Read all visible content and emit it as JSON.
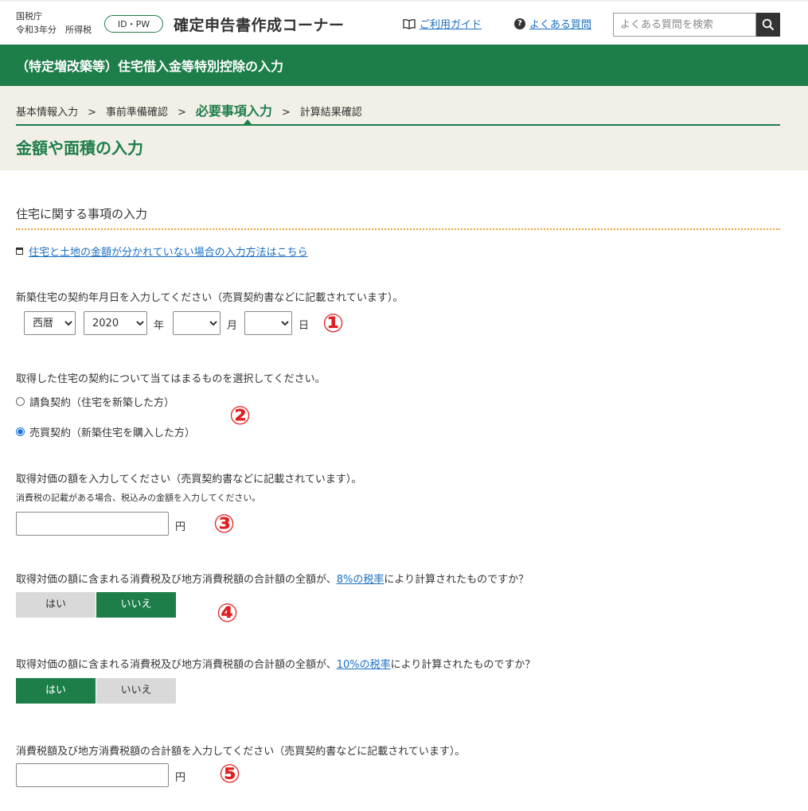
{
  "header": {
    "agency": "国税庁",
    "year_tax": "令和3年分　所得税",
    "badge": "ID・PW",
    "app_title": "確定申告書作成コーナー",
    "guide_link": "ご利用ガイド",
    "faq_link": "よくある質問",
    "search_placeholder": "よくある質問を検索"
  },
  "section_bar": {
    "title": "（特定増改築等）住宅借入金等特別控除の入力"
  },
  "breadcrumb": {
    "steps": [
      "基本情報入力",
      "事前準備確認",
      "必要事項入力",
      "計算結果確認"
    ],
    "separator": ">"
  },
  "page_title": "金額や面積の入力",
  "section": {
    "title": "住宅に関する事項の入力",
    "link": "住宅と土地の金額が分かれていない場合の入力方法はこちら"
  },
  "q1": {
    "label": "新築住宅の契約年月日を入力してください（売買契約書などに記載されています）。",
    "era": "西暦",
    "year": "2020",
    "month": "",
    "day": "",
    "unit_year": "年",
    "unit_month": "月",
    "unit_day": "日",
    "marker": "①"
  },
  "q2": {
    "label": "取得した住宅の契約について当てはまるものを選択してください。",
    "option1": "請負契約（住宅を新築した方）",
    "option2": "売買契約（新築住宅を購入した方）",
    "selected": "option2",
    "marker": "②"
  },
  "q3": {
    "label": "取得対価の額を入力してください（売買契約書などに記載されています）。",
    "note": "消費税の記載がある場合、税込みの金額を入力してください。",
    "value": "",
    "unit": "円",
    "marker": "③"
  },
  "q4": {
    "label_pre": "取得対価の額に含まれる消費税及び地方消費税額の合計額の全額が、",
    "link": "8%の税率",
    "label_post": "により計算されたものですか？",
    "yes": "はい",
    "no": "いいえ",
    "selected": "no",
    "marker": "④"
  },
  "q5": {
    "label_pre": "取得対価の額に含まれる消費税及び地方消費税額の合計額の全額が、",
    "link": "10%の税率",
    "label_post": "により計算されたものですか？",
    "yes": "はい",
    "no": "いいえ",
    "selected": "yes"
  },
  "q6": {
    "label": "消費税額及び地方消費税額の合計額を入力してください（売買契約書などに記載されています）。",
    "value": "",
    "unit": "円",
    "marker": "⑤"
  }
}
